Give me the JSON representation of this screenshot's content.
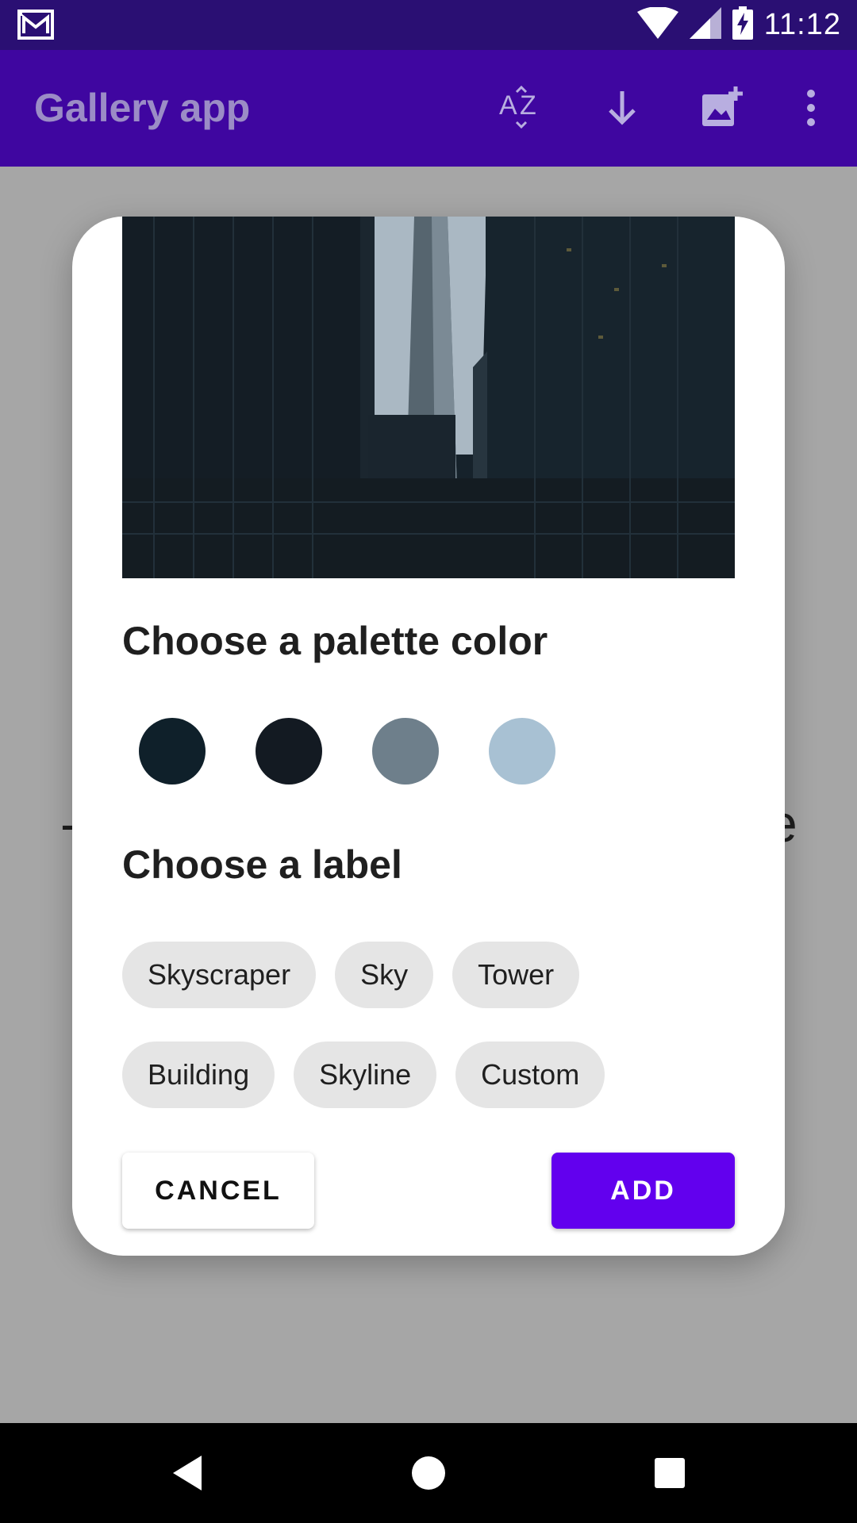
{
  "status_bar": {
    "time": "11:12",
    "icons": [
      "gmail-icon",
      "wifi-icon",
      "signal-icon",
      "battery-charging-icon"
    ]
  },
  "app_bar": {
    "title": "Gallery app",
    "actions": [
      "sort-az-icon",
      "download-icon",
      "add-photo-icon",
      "more-vert-icon"
    ]
  },
  "colors": {
    "status_bar": "#2a0f73",
    "app_bar": "#3f06a0",
    "accent": "#6200ee",
    "scrim": "#a6a6a6",
    "chip_bg": "#e5e5e5"
  },
  "dialog": {
    "palette_title": "Choose a palette color",
    "palette_colors": [
      "#0f202a",
      "#131a22",
      "#6e7f8b",
      "#a8c1d3"
    ],
    "label_title": "Choose a label",
    "labels_row1": [
      "Skyscraper",
      "Sky",
      "Tower"
    ],
    "labels_row2": [
      "Building",
      "Skyline",
      "Custom"
    ],
    "cancel_label": "CANCEL",
    "add_label": "ADD"
  },
  "nav_bar": {
    "buttons": [
      "back-icon",
      "home-icon",
      "recents-icon"
    ]
  }
}
